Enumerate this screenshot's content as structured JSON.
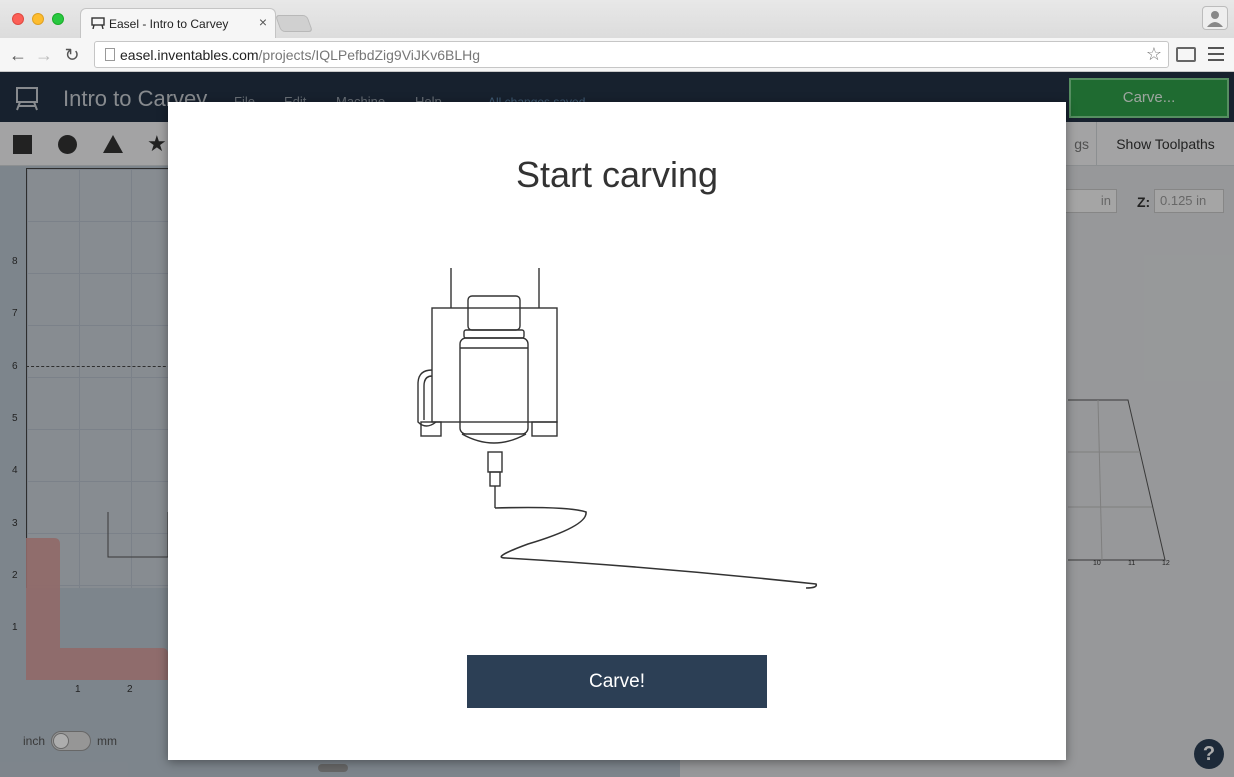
{
  "browser": {
    "tab_title": "Easel - Intro to Carvey",
    "url_host": "easel.inventables.com",
    "url_path": "/projects/IQLPefbdZig9ViJKv6BLHg"
  },
  "app": {
    "title": "Intro to Carvey",
    "menus": [
      "File",
      "Edit",
      "Machine",
      "Help"
    ],
    "save_status": "All changes saved",
    "carve_button": "Carve...",
    "show_toolpaths": "Show Toolpaths",
    "settings_tab": "gs",
    "z_label": "Z:",
    "z_value": "0.125 in",
    "x_value": "in",
    "unit_left": "inch",
    "unit_right": "mm",
    "y_ticks": [
      "8",
      "7",
      "6",
      "5",
      "4",
      "3",
      "2",
      "1"
    ],
    "x_ticks": [
      "1",
      "2"
    ],
    "right_ticks": [
      "10",
      "11",
      "12"
    ],
    "help": "?"
  },
  "modal": {
    "title": "Start carving",
    "carve_button": "Carve!"
  },
  "colors": {
    "appbar": "#223244",
    "carve_green": "#2e9e49",
    "modal_button": "#2c3f55"
  }
}
